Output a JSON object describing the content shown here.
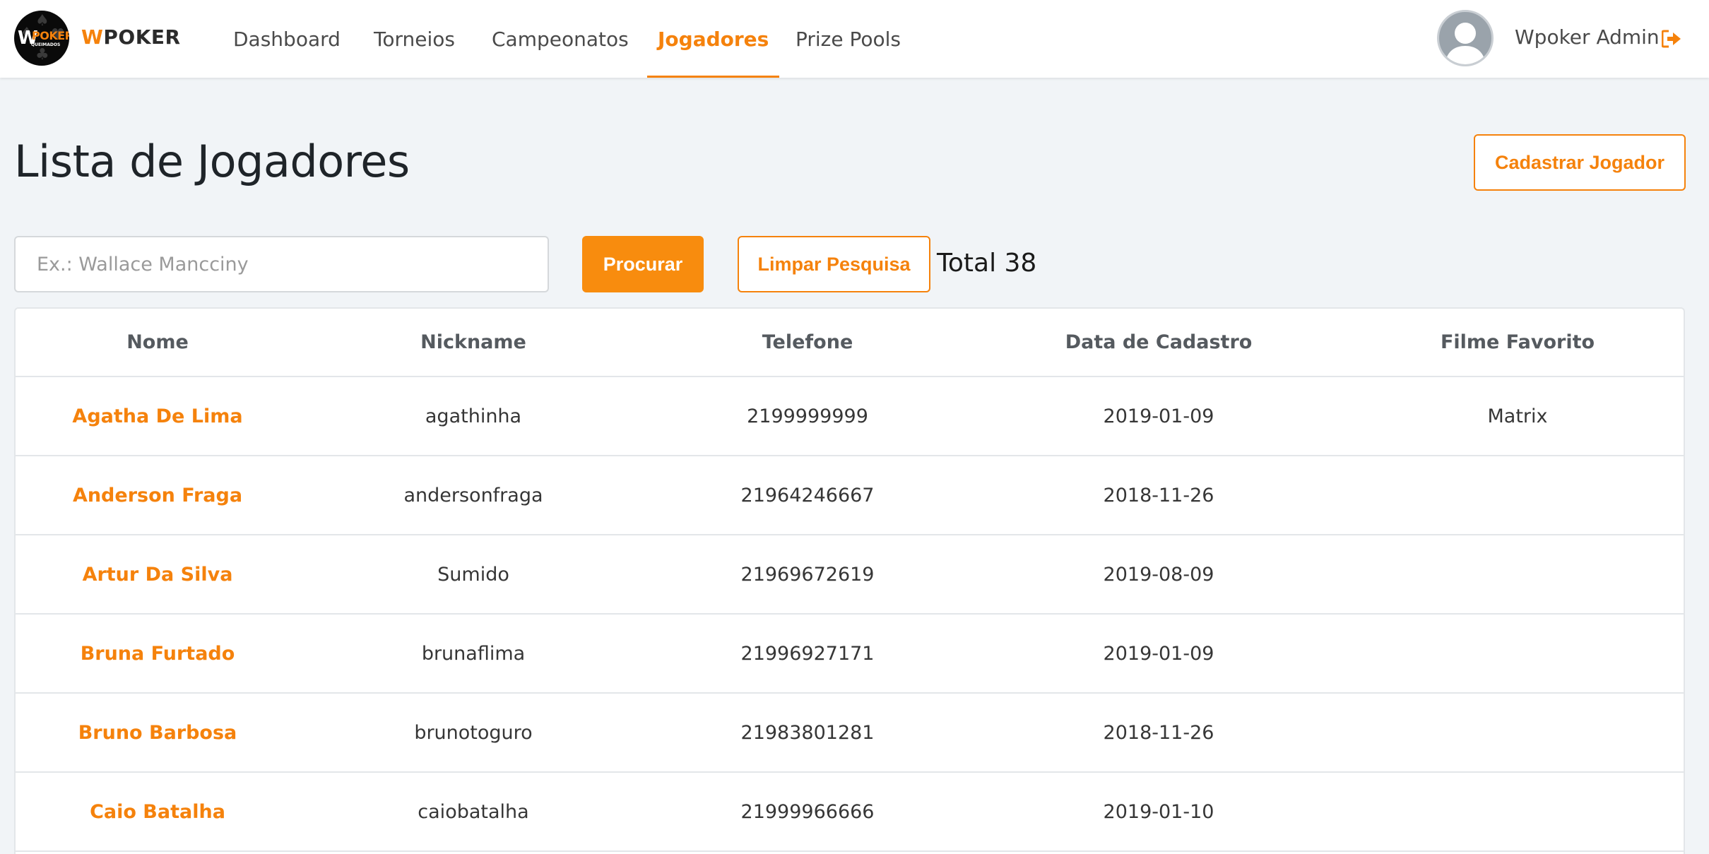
{
  "brand": {
    "logo_w": "W",
    "logo_poker": "POKER",
    "logo_sub": "QUEIMADOS",
    "name_prefix": "W",
    "name_rest": "POKER"
  },
  "nav": {
    "items": [
      {
        "label": "Dashboard"
      },
      {
        "label": "Torneios"
      },
      {
        "label": "Campeonatos"
      },
      {
        "label": "Jogadores",
        "active": true
      },
      {
        "label": "Prize Pools"
      }
    ]
  },
  "user": {
    "name": "Wpoker Admin",
    "logout_icon": "sign-out-icon"
  },
  "page": {
    "title": "Lista de Jogadores",
    "register_button": "Cadastrar Jogador"
  },
  "search": {
    "placeholder": "Ex.: Wallace Mancciny",
    "value": "",
    "submit_label": "Procurar",
    "clear_label": "Limpar Pesquisa",
    "total_label": "Total 38"
  },
  "table": {
    "columns": [
      "Nome",
      "Nickname",
      "Telefone",
      "Data de Cadastro",
      "Filme Favorito"
    ],
    "rows": [
      {
        "nome": "Agatha De Lima",
        "nickname": "agathinha",
        "telefone": "2199999999",
        "data": "2019-01-09",
        "filme": "Matrix"
      },
      {
        "nome": "Anderson Fraga",
        "nickname": "andersonfraga",
        "telefone": "21964246667",
        "data": "2018-11-26",
        "filme": ""
      },
      {
        "nome": "Artur Da Silva",
        "nickname": "Sumido",
        "telefone": "21969672619",
        "data": "2019-08-09",
        "filme": ""
      },
      {
        "nome": "Bruna Furtado",
        "nickname": "brunaflima",
        "telefone": "21996927171",
        "data": "2019-01-09",
        "filme": ""
      },
      {
        "nome": "Bruno Barbosa",
        "nickname": "brunotoguro",
        "telefone": "21983801281",
        "data": "2018-11-26",
        "filme": ""
      },
      {
        "nome": "Caio Batalha",
        "nickname": "caiobatalha",
        "telefone": "21999966666",
        "data": "2019-01-10",
        "filme": ""
      }
    ]
  },
  "colors": {
    "accent": "#f5820c",
    "background": "#f1f4f7"
  }
}
